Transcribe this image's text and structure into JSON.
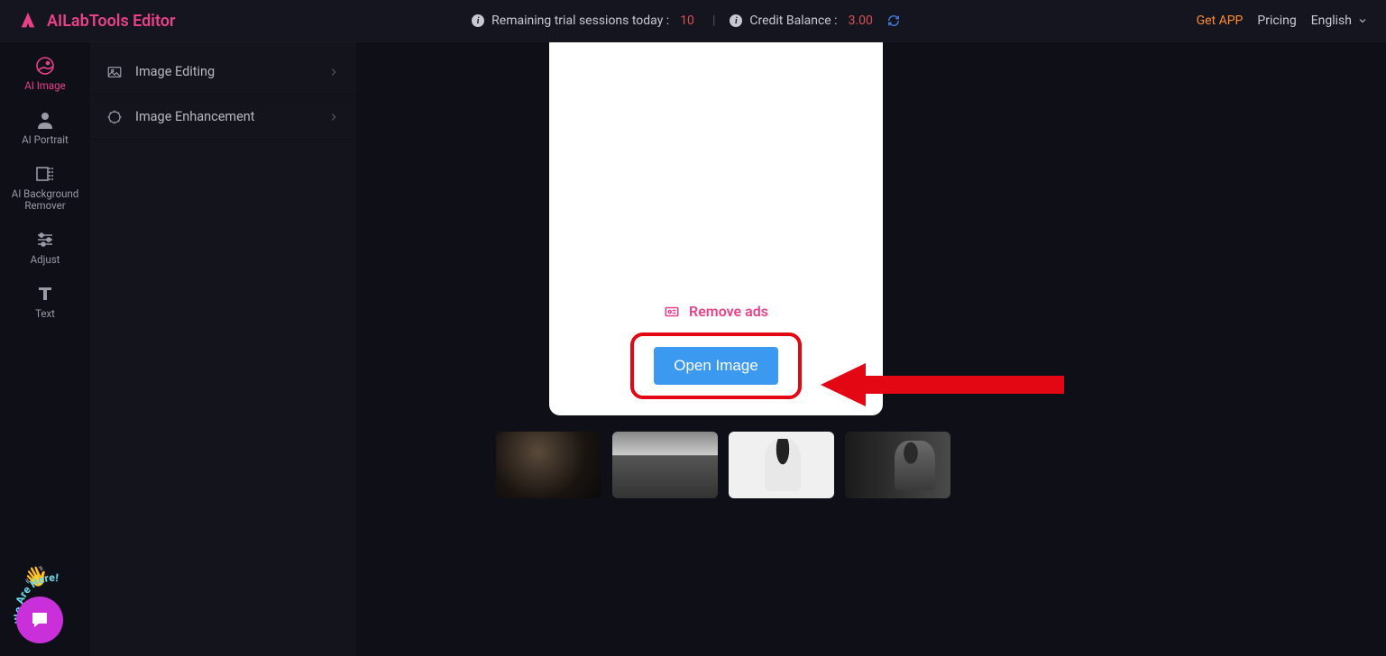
{
  "header": {
    "brand": "AILabTools Editor",
    "trial_label": "Remaining trial sessions today :",
    "trial_value": "10",
    "credit_label": "Credit Balance :",
    "credit_value": "3.00",
    "get_app": "Get APP",
    "pricing": "Pricing",
    "language": "English"
  },
  "sidebar_primary": [
    {
      "label": "AI Image",
      "icon": "ai-image-icon",
      "active": true
    },
    {
      "label": "AI Portrait",
      "icon": "ai-portrait-icon",
      "active": false
    },
    {
      "label": "AI Background Remover",
      "icon": "ai-bg-remover-icon",
      "active": false
    },
    {
      "label": "Adjust",
      "icon": "adjust-icon",
      "active": false
    },
    {
      "label": "Text",
      "icon": "text-icon",
      "active": false
    }
  ],
  "sidebar_secondary": [
    {
      "label": "Image Editing",
      "icon": "image-editing-icon"
    },
    {
      "label": "Image Enhancement",
      "icon": "image-enhancement-icon"
    }
  ],
  "canvas": {
    "remove_ads": "Remove ads",
    "open_image": "Open Image"
  },
  "chat": {
    "arc_text": "We Are Here!"
  }
}
